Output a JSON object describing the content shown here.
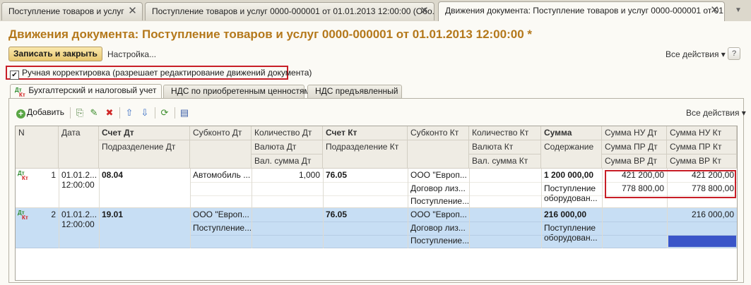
{
  "window_tabs": [
    {
      "label": "Поступление товаров и услуг"
    },
    {
      "label": "Поступление товаров и услуг 0000-000001 от 01.01.2013 12:00:00 (Обо..."
    },
    {
      "label": "Движения документа: Поступление товаров и услуг 0000-000001 от 01..."
    }
  ],
  "tab_close_glyph": "✕",
  "title": "Движения документа: Поступление товаров и услуг 0000-000001 от 01.01.2013 12:00:00 *",
  "toolbar": {
    "save_close": "Записать и закрыть",
    "settings": "Настройка...",
    "all_actions": "Все действия ▾",
    "help": "?"
  },
  "manual_correction": {
    "checked": true,
    "label": "Ручная корректировка (разрешает редактирование движений документа)"
  },
  "inner_tabs": [
    {
      "label": "Бухгалтерский и налоговый учет"
    },
    {
      "label": "НДС по приобретенным ценностям"
    },
    {
      "label": "НДС предъявленный"
    }
  ],
  "dtkt_icon": {
    "dt": "Дт",
    "kt": "Кт"
  },
  "grid_toolbar": {
    "add": "Добавить",
    "all_actions": "Все действия ▾"
  },
  "icon_glyphs": {
    "pencil": "✎",
    "delete": "✖",
    "up": "⇧",
    "down": "⇩",
    "refresh": "⟳",
    "report": "▤",
    "copy": "⎘",
    "plus": "+"
  },
  "columns": {
    "row1": [
      "N",
      "Дата",
      "Счет Дт",
      "Субконто Дт",
      "Количество Дт",
      "Счет Кт",
      "Субконто Кт",
      "Количество Кт",
      "Сумма",
      "Сумма НУ Дт",
      "Сумма НУ Кт"
    ],
    "row2": [
      "",
      "",
      "Подразделение Дт",
      "",
      "Валюта Дт",
      "Подразделение Кт",
      "",
      "Валюта Кт",
      "Содержание",
      "Сумма ПР Дт",
      "Сумма ПР Кт"
    ],
    "row3": [
      "",
      "",
      "",
      "",
      "Вал. сумма Дт",
      "",
      "",
      "Вал. сумма Кт",
      "",
      "Сумма ВР Дт",
      "Сумма ВР Кт"
    ]
  },
  "rows": [
    {
      "n": "1",
      "date": "01.01.2...",
      "time": "12:00:00",
      "account_dt": "08.04",
      "subconto_dt": [
        "Автомобиль ...",
        ""
      ],
      "qty_dt": "1,000",
      "account_kt": "76.05",
      "subconto_kt": [
        "ООО \"Европ...",
        "Договор лиз...",
        "Поступление..."
      ],
      "amount": "1 200 000,00",
      "content": [
        "Поступление",
        "оборудован..."
      ],
      "nu_dt": "421 200,00",
      "nu_kt": "421 200,00",
      "pr_dt": "778 800,00",
      "pr_kt": "778 800,00"
    },
    {
      "n": "2",
      "date": "01.01.2...",
      "time": "12:00:00",
      "account_dt": "19.01",
      "subconto_dt": [
        "ООО \"Европ...",
        "Поступление..."
      ],
      "qty_dt": "",
      "account_kt": "76.05",
      "subconto_kt": [
        "ООО \"Европ...",
        "Договор лиз...",
        "Поступление..."
      ],
      "amount": "216 000,00",
      "content": [
        "Поступление",
        "оборудован..."
      ],
      "nu_dt": "",
      "nu_kt": "216 000,00",
      "pr_dt": "",
      "pr_kt": ""
    }
  ]
}
